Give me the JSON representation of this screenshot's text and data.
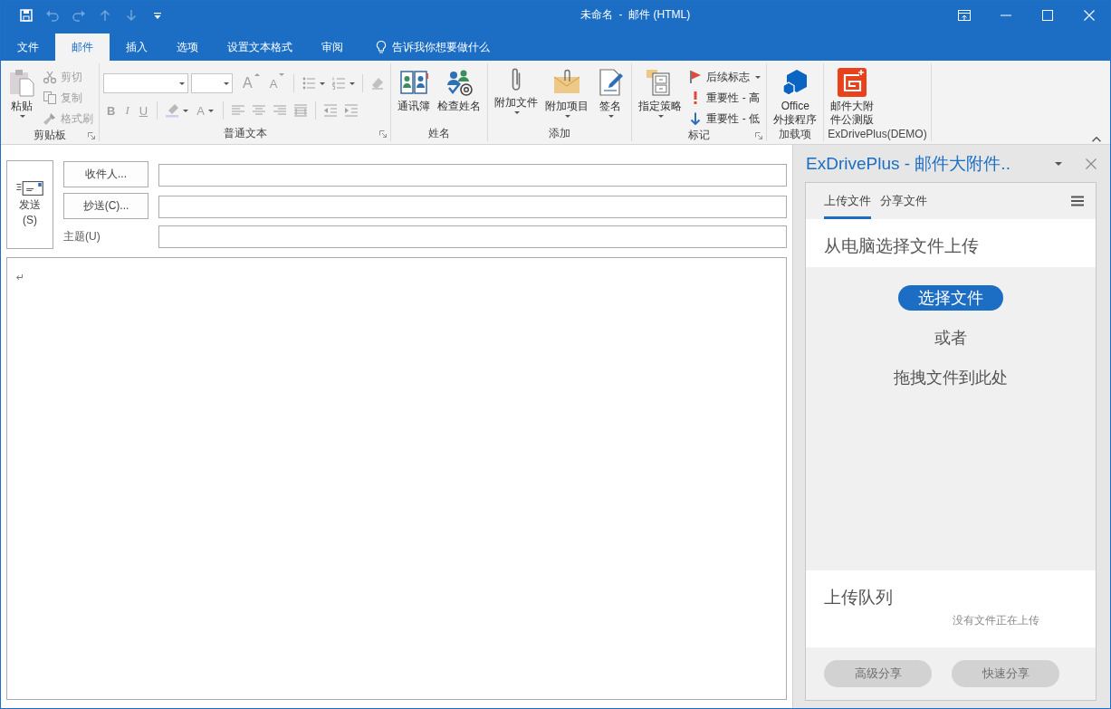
{
  "window": {
    "title": "未命名  -  邮件 (HTML)"
  },
  "quick_access": [
    {
      "kind": "save",
      "disabled": false
    },
    {
      "kind": "undo",
      "disabled": true
    },
    {
      "kind": "redo",
      "disabled": true
    },
    {
      "kind": "up",
      "disabled": true
    },
    {
      "kind": "down",
      "disabled": true
    },
    {
      "kind": "customize",
      "disabled": false
    }
  ],
  "tabs": [
    {
      "label": "文件",
      "selected": false
    },
    {
      "label": "邮件",
      "selected": true
    },
    {
      "label": "插入",
      "selected": false
    },
    {
      "label": "选项",
      "selected": false
    },
    {
      "label": "设置文本格式",
      "selected": false
    },
    {
      "label": "审阅",
      "selected": false
    }
  ],
  "tell_me": "告诉我你想要做什么",
  "ribbon": [
    {
      "label": "剪贴板",
      "launcher": true,
      "buttons": [
        {
          "kind": "paste",
          "label": "粘贴",
          "dropdown": true,
          "disabled": false
        }
      ],
      "small_buttons": [
        {
          "kind": "cut",
          "label": "剪切",
          "dropdown": false,
          "disabled": true
        },
        {
          "kind": "copy",
          "label": "复制",
          "dropdown": false,
          "disabled": true
        },
        {
          "kind": "brush",
          "label": "格式刷",
          "dropdown": false,
          "disabled": true
        }
      ]
    },
    {
      "label": "普通文本",
      "launcher": true,
      "format_disabled": true,
      "format_rows": [
        [
          {
            "kind": "font_box"
          },
          {
            "kind": "size_box"
          },
          {
            "kind": "grow",
            "text": "A"
          },
          {
            "kind": "shrink",
            "text": "A"
          },
          {
            "kind": "sep"
          },
          {
            "kind": "bullets",
            "dropdown": true
          },
          {
            "kind": "numbering",
            "dropdown": true
          },
          {
            "kind": "sep"
          },
          {
            "kind": "eraser",
            "dropdown": false
          }
        ],
        [
          {
            "kind": "bold",
            "text": "B"
          },
          {
            "kind": "italic",
            "text": "I"
          },
          {
            "kind": "underline",
            "text": "U"
          },
          {
            "kind": "sep"
          },
          {
            "kind": "highlighter",
            "dropdown": true
          },
          {
            "kind": "font_color",
            "text": "A"
          },
          {
            "kind": "sep"
          },
          {
            "kind": "align_left",
            "dropdown": false
          },
          {
            "kind": "align_center",
            "dropdown": false
          },
          {
            "kind": "align_right",
            "dropdown": false
          },
          {
            "kind": "justify",
            "dropdown": false
          },
          {
            "kind": "sep"
          },
          {
            "kind": "outdent",
            "dropdown": false
          },
          {
            "kind": "indent",
            "dropdown": false
          }
        ]
      ]
    },
    {
      "label": "姓名",
      "launcher": false,
      "buttons": [
        {
          "kind": "book",
          "label": "通讯簿",
          "dropdown": false,
          "disabled": false
        },
        {
          "kind": "people",
          "label": "检查姓名",
          "dropdown": false,
          "disabled": false
        }
      ]
    },
    {
      "label": "添加",
      "launcher": false,
      "buttons": [
        {
          "kind": "clip",
          "label": "附加文件",
          "dropdown": true,
          "disabled": false
        },
        {
          "kind": "envclip",
          "label": "附加项目",
          "dropdown": true,
          "disabled": false
        },
        {
          "kind": "signature",
          "label": "签名",
          "dropdown": true,
          "disabled": false
        }
      ]
    },
    {
      "label": "标记",
      "launcher": true,
      "buttons": [
        {
          "kind": "cabinet",
          "label": "指定策略",
          "dropdown": true,
          "disabled": false
        }
      ],
      "small_buttons": [
        {
          "kind": "flag",
          "label": "后续标志",
          "dropdown": true,
          "disabled": false
        },
        {
          "kind": "exclaim",
          "label": "重要性 - 高",
          "dropdown": false,
          "disabled": false
        },
        {
          "kind": "arrowdown",
          "label": "重要性 - 低",
          "dropdown": false,
          "disabled": false
        }
      ]
    },
    {
      "label": "加载项",
      "launcher": false,
      "buttons": [
        {
          "kind": "cubes",
          "label": "Office\n外接程序",
          "dropdown": false,
          "disabled": false
        }
      ]
    },
    {
      "label": "ExDrivePlus(DEMO)",
      "launcher": false,
      "buttons": [
        {
          "kind": "exdrive",
          "label": "邮件大附件公测版",
          "dropdown": false,
          "disabled": false
        }
      ]
    }
  ],
  "compose": {
    "send": "发送\n(S)",
    "to_button": "收件人...",
    "cc_button": "抄送(C)...",
    "subject_label": "主题(U)",
    "body_mark": "↵"
  },
  "pane": {
    "title": "ExDrivePlus - 邮件大附件..",
    "tabs": [
      {
        "label": "上传文件",
        "selected": true
      },
      {
        "label": "分享文件",
        "selected": false
      }
    ],
    "upload_heading": "从电脑选择文件上传",
    "choose_button": "选择文件",
    "or_text": "或者",
    "drop_text": "拖拽文件到此处",
    "queue_heading": "上传队列",
    "queue_empty": "没有文件正在上传",
    "actions": [
      {
        "label": "高级分享",
        "disabled": true
      },
      {
        "label": "快速分享",
        "disabled": true
      }
    ]
  }
}
